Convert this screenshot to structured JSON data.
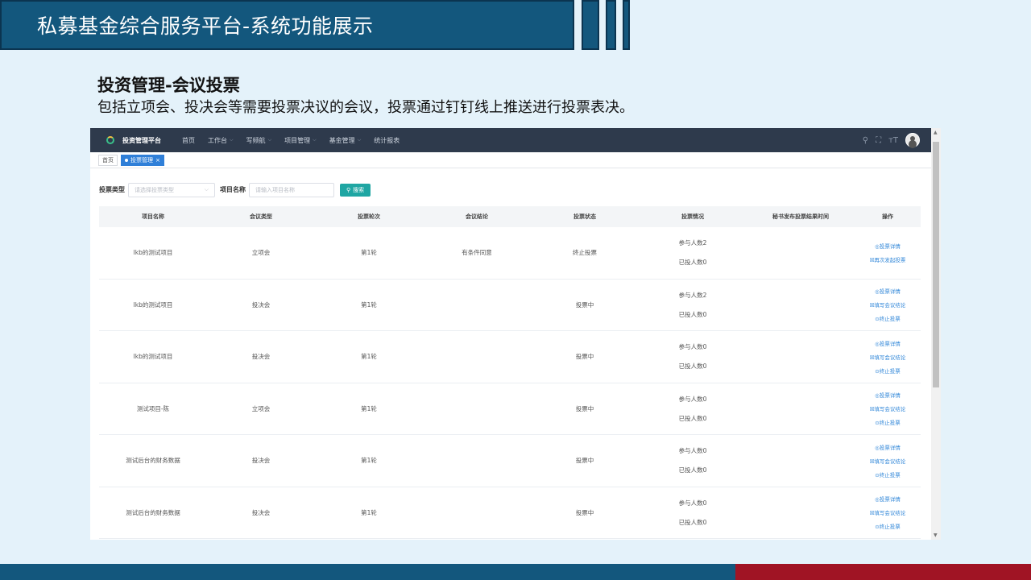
{
  "slide": {
    "title": "私募基金综合服务平台-系统功能展示",
    "section_title": "投资管理-会议投票",
    "section_desc": "包括立项会、投决会等需要投票决议的会议，投票通过钉钉线上推送进行投票表决。"
  },
  "colors": {
    "header": "#13577d",
    "footer_red": "#a01424",
    "nav_bg": "#2e3a4c",
    "accent": "#2f7fd8",
    "search_btn": "#1fa6a3"
  },
  "app": {
    "brand": "投资管理平台",
    "nav": [
      "首页",
      "工作台",
      "写频航",
      "项目管理",
      "基金管理",
      "统计报表"
    ],
    "nav_icons": [
      "search-icon",
      "fullscreen-icon",
      "font-size-icon",
      "avatar"
    ],
    "tags": {
      "home": "首页",
      "active": "投票管理"
    },
    "filter": {
      "type_label": "投票类型",
      "type_placeholder": "请选择投票类型",
      "name_label": "项目名称",
      "name_placeholder": "请输入项目名称",
      "search": "搜索"
    },
    "table": {
      "headers": [
        "项目名称",
        "会议类型",
        "投票轮次",
        "会议结论",
        "投票状态",
        "投票情况",
        "秘书发布投票结果时间",
        "操作"
      ],
      "rows": [
        {
          "name": "lkb的测试项目",
          "meeting": "立项会",
          "round": "第1轮",
          "conclusion": "有条件同意",
          "status": "终止投票",
          "joined": "参与人数2",
          "voted": "已投人数0",
          "time": "",
          "ops": [
            "◎投票详情",
            "☒再次发起投票"
          ]
        },
        {
          "name": "lkb的测试项目",
          "meeting": "投决会",
          "round": "第1轮",
          "conclusion": "",
          "status": "投票中",
          "joined": "参与人数2",
          "voted": "已投人数0",
          "time": "",
          "ops": [
            "◎投票详情",
            "☒填写会议结论",
            "⊙终止投票"
          ]
        },
        {
          "name": "lkb的测试项目",
          "meeting": "投决会",
          "round": "第1轮",
          "conclusion": "",
          "status": "投票中",
          "joined": "参与人数0",
          "voted": "已投人数0",
          "time": "",
          "ops": [
            "◎投票详情",
            "☒填写会议结论",
            "⊙终止投票"
          ]
        },
        {
          "name": "测试项目-陈",
          "meeting": "立项会",
          "round": "第1轮",
          "conclusion": "",
          "status": "投票中",
          "joined": "参与人数0",
          "voted": "已投人数0",
          "time": "",
          "ops": [
            "◎投票详情",
            "☒填写会议结论",
            "⊙终止投票"
          ]
        },
        {
          "name": "测试后台的财务数据",
          "meeting": "投决会",
          "round": "第1轮",
          "conclusion": "",
          "status": "投票中",
          "joined": "参与人数0",
          "voted": "已投人数0",
          "time": "",
          "ops": [
            "◎投票详情",
            "☒填写会议结论",
            "⊙终止投票"
          ]
        },
        {
          "name": "测试后台的财务数据",
          "meeting": "投决会",
          "round": "第1轮",
          "conclusion": "",
          "status": "投票中",
          "joined": "参与人数0",
          "voted": "已投人数0",
          "time": "",
          "ops": [
            "◎投票详情",
            "☒填写会议结论",
            "⊙终止投票"
          ]
        }
      ]
    }
  }
}
